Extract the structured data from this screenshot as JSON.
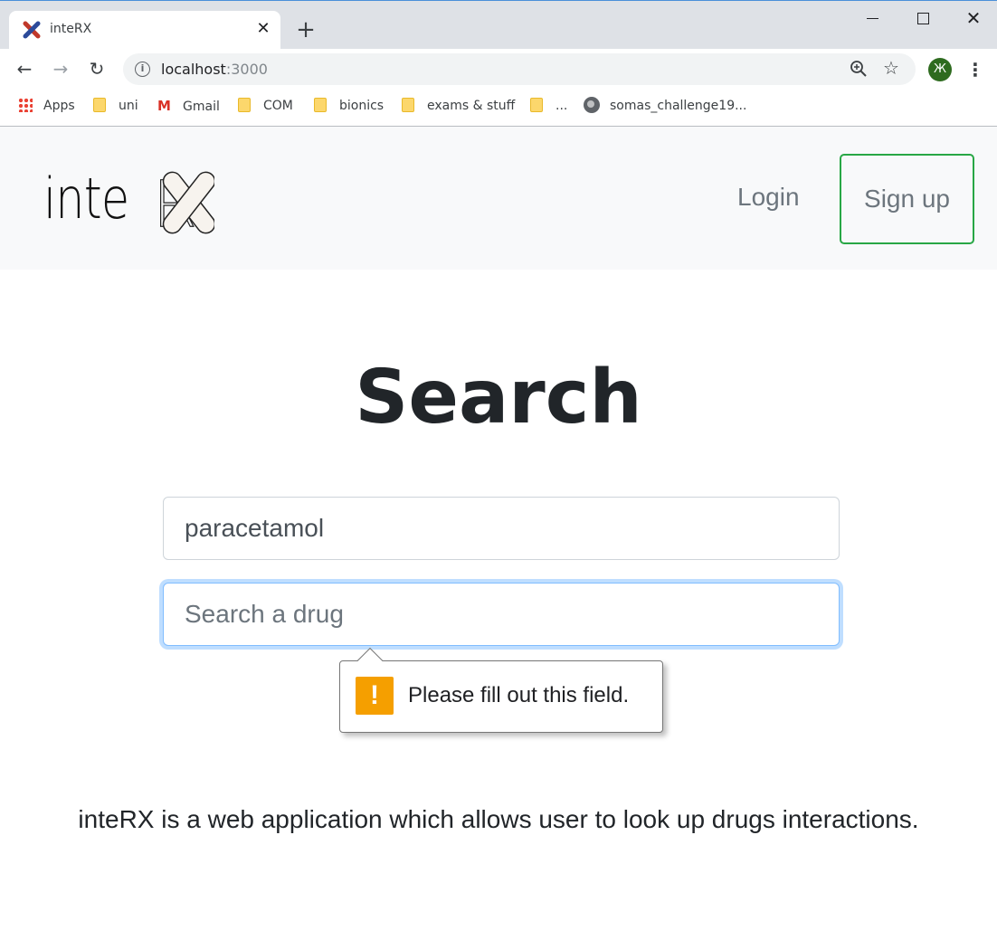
{
  "browser": {
    "tab_title": "inteRX",
    "new_tab": "+",
    "url_host": "localhost",
    "url_port": ":3000",
    "profile_initial": "Ж",
    "bookmarks": [
      {
        "label": "Apps",
        "icon": "apps-grid-icon"
      },
      {
        "label": "uni",
        "icon": "folder-icon"
      },
      {
        "label": "Gmail",
        "icon": "gmail-icon"
      },
      {
        "label": "COM",
        "icon": "folder-icon"
      },
      {
        "label": "bionics",
        "icon": "folder-icon"
      },
      {
        "label": "exams & stuff",
        "icon": "folder-icon"
      },
      {
        "label": "...",
        "icon": "folder-icon"
      },
      {
        "label": "somas_challenge19...",
        "icon": "globe-icon"
      }
    ]
  },
  "navbar": {
    "logo_text": "inteRX",
    "login": "Login",
    "signup": "Sign up"
  },
  "main": {
    "heading": "Search",
    "drug1_value": "paracetamol",
    "drug2_placeholder": "Search a drug",
    "validation_message": "Please fill out this field.",
    "description": "inteRX is a web application which allows user to look up drugs interactions."
  },
  "colors": {
    "signup_border": "#28a745",
    "focus_ring": "#80bdff",
    "warning": "#f59f00",
    "navbar_bg": "#f8f9fa"
  }
}
